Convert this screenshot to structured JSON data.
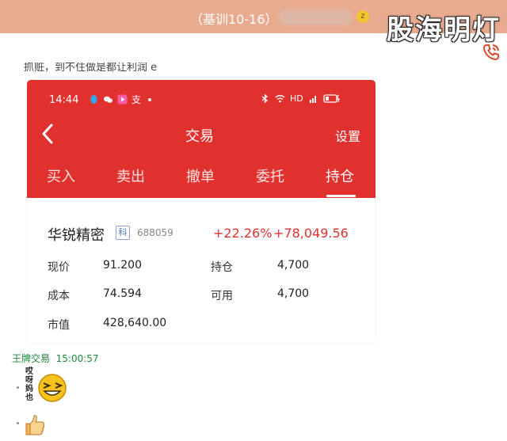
{
  "chat": {
    "title": "（基训10-16）",
    "watermark": "股海明灯",
    "cut_text": "抓赃，到不住做是都让利润 e",
    "sender": "王牌交易",
    "time": "15:00:57",
    "sticker_text": "哎呀妈也"
  },
  "phone": {
    "time": "14:44",
    "status_extra": "HD",
    "nav_title": "交易",
    "settings": "设置",
    "tabs": [
      "买入",
      "卖出",
      "撤单",
      "委托",
      "持仓"
    ],
    "active_tab": "持仓"
  },
  "stock": {
    "name": "华锐精密",
    "tag": "科",
    "code": "688059",
    "pct": "+22.26%",
    "amount": "+78,049.56",
    "rows": [
      {
        "l1": "现价",
        "v1": "91.200",
        "l2": "持仓",
        "v2": "4,700"
      },
      {
        "l1": "成本",
        "v1": "74.594",
        "l2": "可用",
        "v2": "4,700"
      },
      {
        "l1": "市值",
        "v1": "428,640.00",
        "l2": "",
        "v2": ""
      }
    ]
  },
  "colors": {
    "header": "#e9ab8f",
    "brand_red": "#e1312f",
    "sender_green": "#1b8a3a"
  }
}
